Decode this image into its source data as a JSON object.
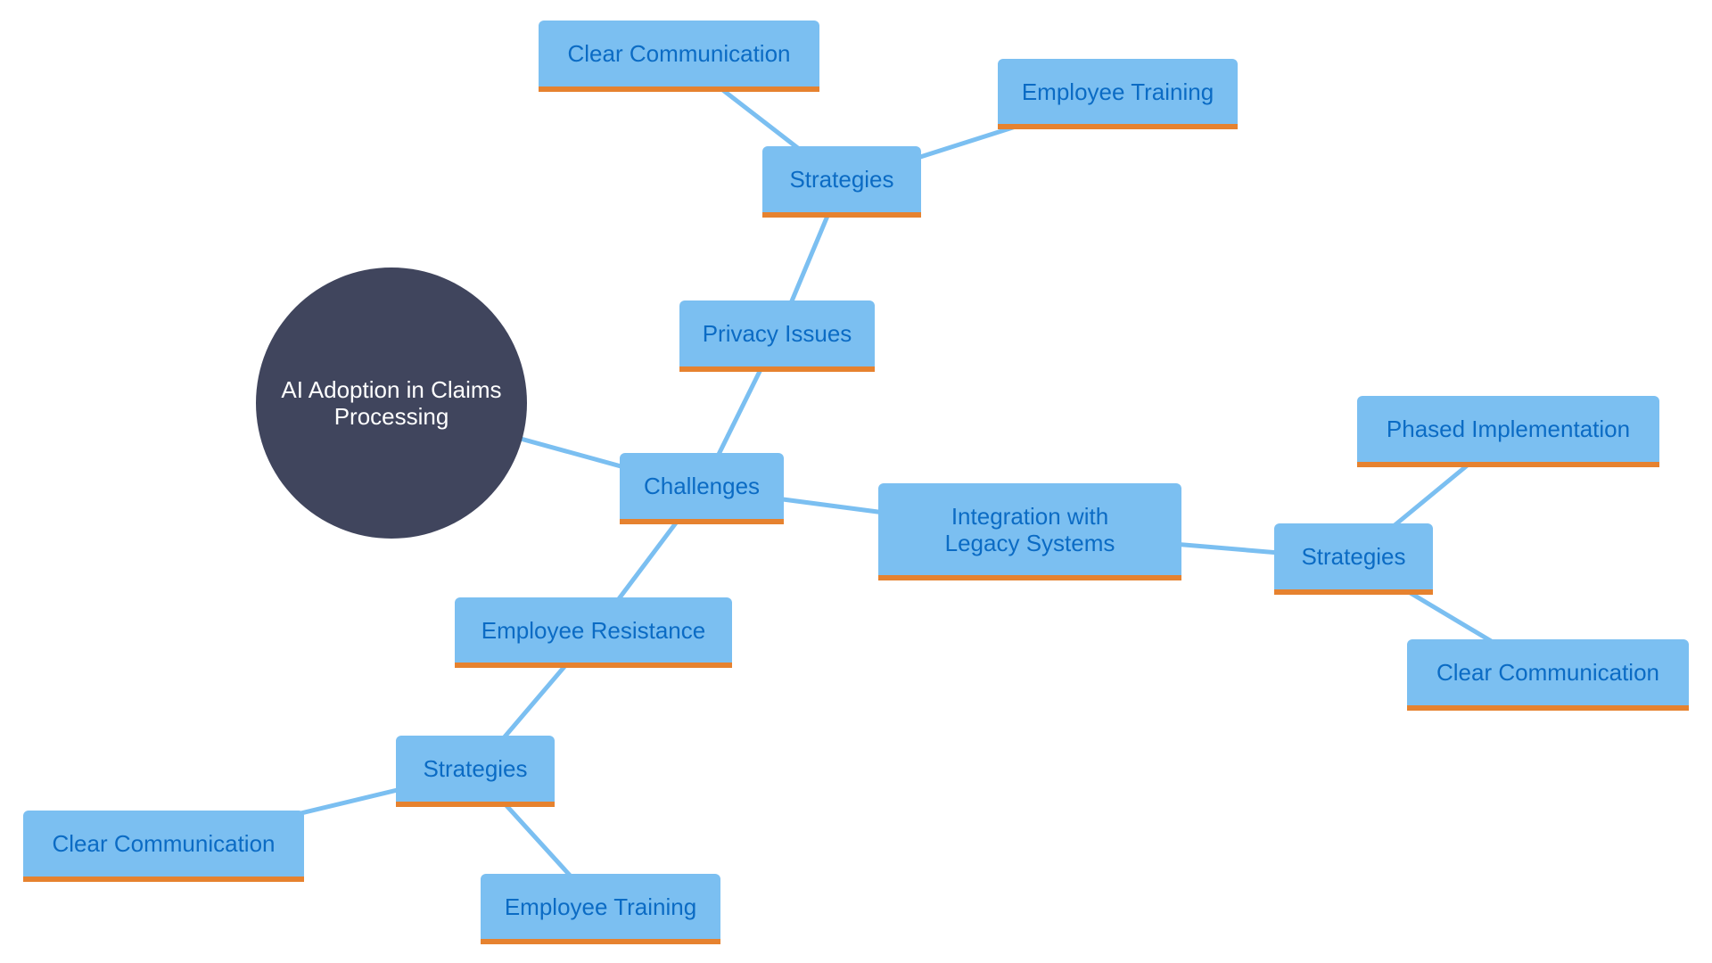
{
  "diagram": {
    "type": "mindmap",
    "colors": {
      "root_fill": "#40455d",
      "root_text": "#ffffff",
      "node_fill": "#7bbff1",
      "node_text": "#0b6bc4",
      "node_accent": "#e6822f",
      "edge": "#7bbff1"
    },
    "root": {
      "id": "root",
      "label": "AI Adoption in Claims Processing"
    },
    "nodes": [
      {
        "id": "challenges",
        "label": "Challenges",
        "parent": "root"
      },
      {
        "id": "privacy",
        "label": "Privacy Issues",
        "parent": "challenges"
      },
      {
        "id": "privacy_strategies",
        "label": "Strategies",
        "parent": "privacy"
      },
      {
        "id": "privacy_clear_comm",
        "label": "Clear Communication",
        "parent": "privacy_strategies"
      },
      {
        "id": "privacy_training",
        "label": "Employee Training",
        "parent": "privacy_strategies"
      },
      {
        "id": "integration",
        "label": "Integration with Legacy Systems",
        "parent": "challenges"
      },
      {
        "id": "integration_strategies",
        "label": "Strategies",
        "parent": "integration"
      },
      {
        "id": "integration_phased",
        "label": "Phased Implementation",
        "parent": "integration_strategies"
      },
      {
        "id": "integration_clear_comm",
        "label": "Clear Communication",
        "parent": "integration_strategies"
      },
      {
        "id": "resistance",
        "label": "Employee Resistance",
        "parent": "challenges"
      },
      {
        "id": "resistance_strategies",
        "label": "Strategies",
        "parent": "resistance"
      },
      {
        "id": "resistance_clear_comm",
        "label": "Clear Communication",
        "parent": "resistance_strategies"
      },
      {
        "id": "resistance_training",
        "label": "Employee Training",
        "parent": "resistance_strategies"
      }
    ]
  }
}
